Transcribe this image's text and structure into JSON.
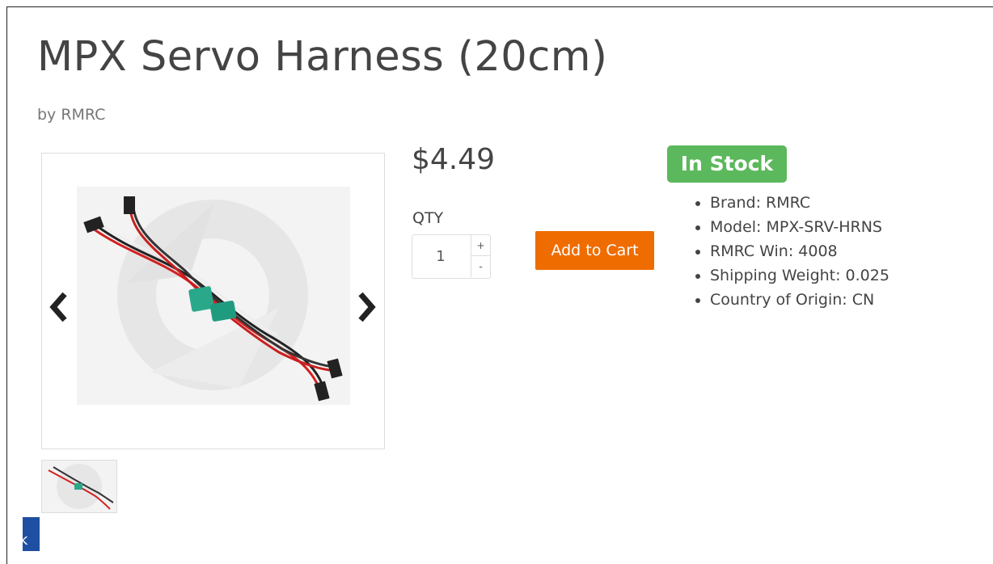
{
  "product": {
    "title": "MPX Servo Harness (20cm)",
    "by_prefix": "by",
    "brand_link": "RMRC",
    "price": "$4.49",
    "stock_status": "In Stock",
    "stock_color": "#5cb85c"
  },
  "purchase": {
    "qty_label": "QTY",
    "qty_value": "1",
    "plus": "+",
    "minus": "-",
    "add_to_cart": "Add to Cart",
    "button_color": "#ef6c00"
  },
  "specs": [
    "Brand: RMRC",
    "Model: MPX-SRV-HRNS",
    "RMRC Win: 4008",
    "Shipping Weight: 0.025",
    "Country of Origin: CN"
  ],
  "gallery": {
    "prev_icon": "chevron-left-icon",
    "next_icon": "chevron-right-icon"
  },
  "corner_badge": {
    "label": "k",
    "color": "#1f4fa2"
  }
}
